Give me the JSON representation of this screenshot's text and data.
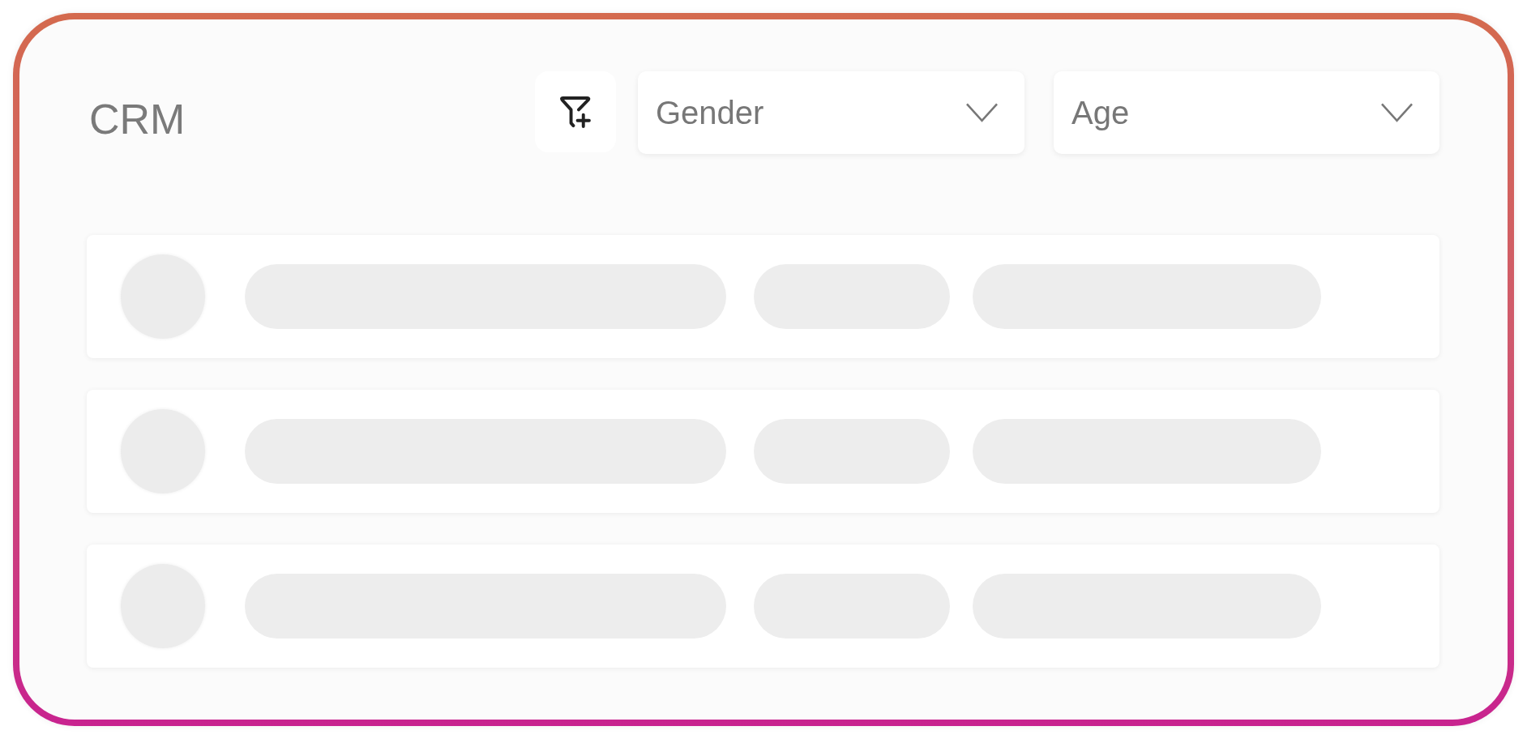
{
  "title": "CRM",
  "filter_button": {
    "kind": "add-filter"
  },
  "dropdowns": [
    {
      "label": "Gender"
    },
    {
      "label": "Age"
    }
  ],
  "rows": [
    {
      "kind": "skeleton"
    },
    {
      "kind": "skeleton"
    },
    {
      "kind": "skeleton"
    }
  ]
}
